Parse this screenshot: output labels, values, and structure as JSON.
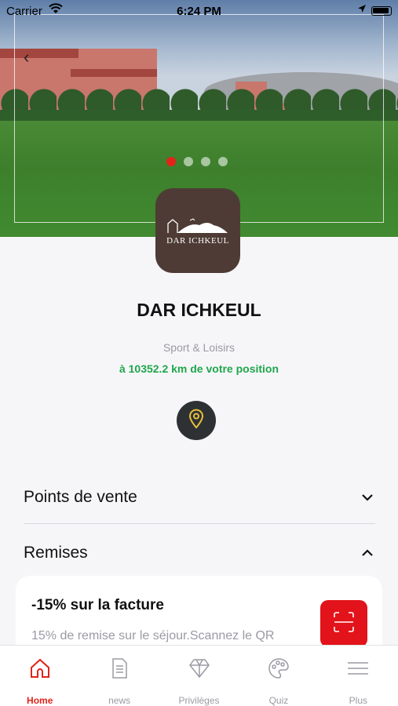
{
  "status_bar": {
    "carrier": "Carrier",
    "time": "6:24 PM"
  },
  "place": {
    "name": "DAR ICHKEUL",
    "logo_text": "DAR ICHKEUL",
    "category": "Sport & Loisirs",
    "distance": "à 10352.2 km de votre position"
  },
  "carousel": {
    "slides": 4,
    "active_index": 0
  },
  "sections": {
    "points_de_vente": "Points de vente",
    "remises": "Remises"
  },
  "discount": {
    "title": "-15% sur la facture",
    "description": "15% de remise sur le séjour.Scannez le QR"
  },
  "tabs": [
    {
      "label": "Home",
      "icon": "home-icon",
      "active": true
    },
    {
      "label": "news",
      "icon": "document-icon",
      "active": false
    },
    {
      "label": "Privilèges",
      "icon": "diamond-icon",
      "active": false
    },
    {
      "label": "Quiz",
      "icon": "palette-icon",
      "active": false
    },
    {
      "label": "Plus",
      "icon": "menu-icon",
      "active": false
    }
  ],
  "colors": {
    "accent": "#e2231a",
    "distance": "#1fa64a",
    "logo_bg": "#4e3b35",
    "pin_bg": "#2e3134"
  }
}
